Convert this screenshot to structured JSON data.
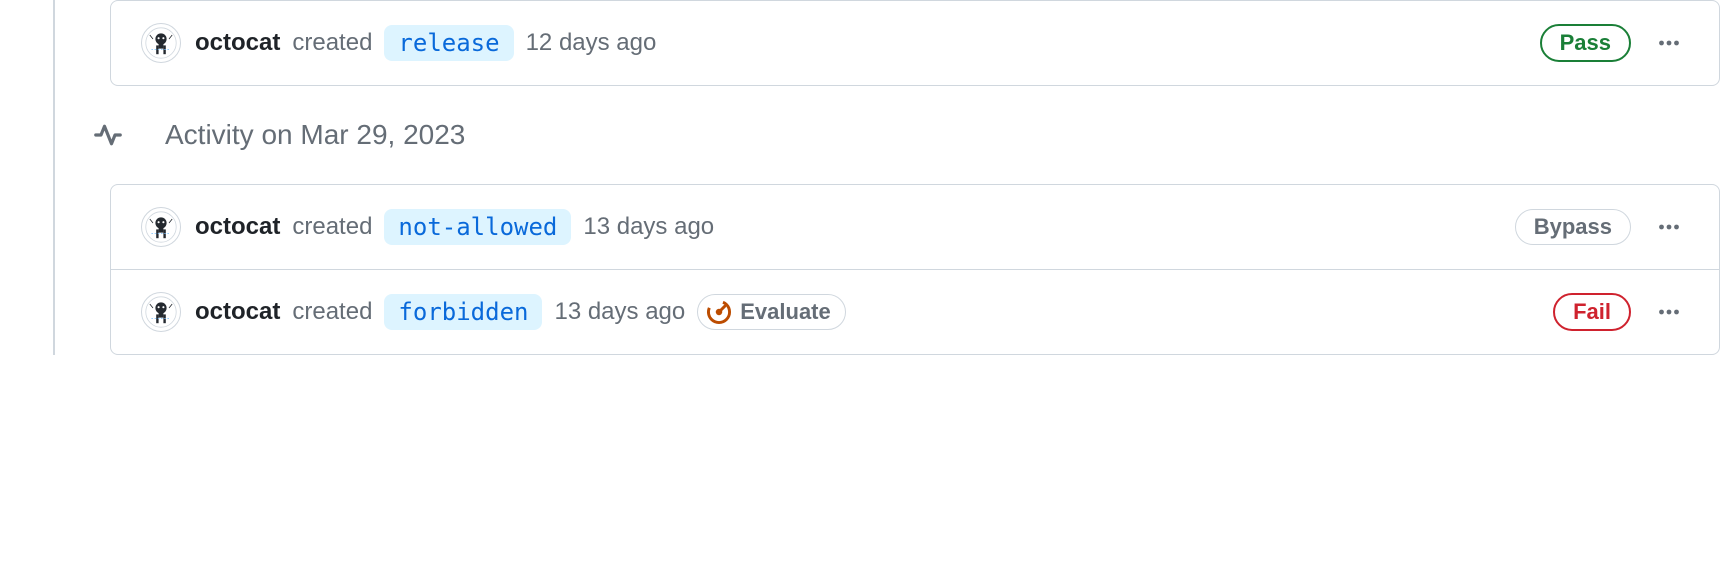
{
  "groups": [
    {
      "items": [
        {
          "username": "octocat",
          "verb": "created",
          "branch": "release",
          "timestamp": "12 days ago",
          "status": {
            "label": "Pass",
            "kind": "pass"
          },
          "evaluate": null
        }
      ]
    }
  ],
  "dateMarker": "Activity on Mar 29, 2023",
  "group2": {
    "items": [
      {
        "username": "octocat",
        "verb": "created",
        "branch": "not-allowed",
        "timestamp": "13 days ago",
        "status": {
          "label": "Bypass",
          "kind": "bypass"
        },
        "evaluate": null
      },
      {
        "username": "octocat",
        "verb": "created",
        "branch": "forbidden",
        "timestamp": "13 days ago",
        "status": {
          "label": "Fail",
          "kind": "fail"
        },
        "evaluate": "Evaluate"
      }
    ]
  }
}
